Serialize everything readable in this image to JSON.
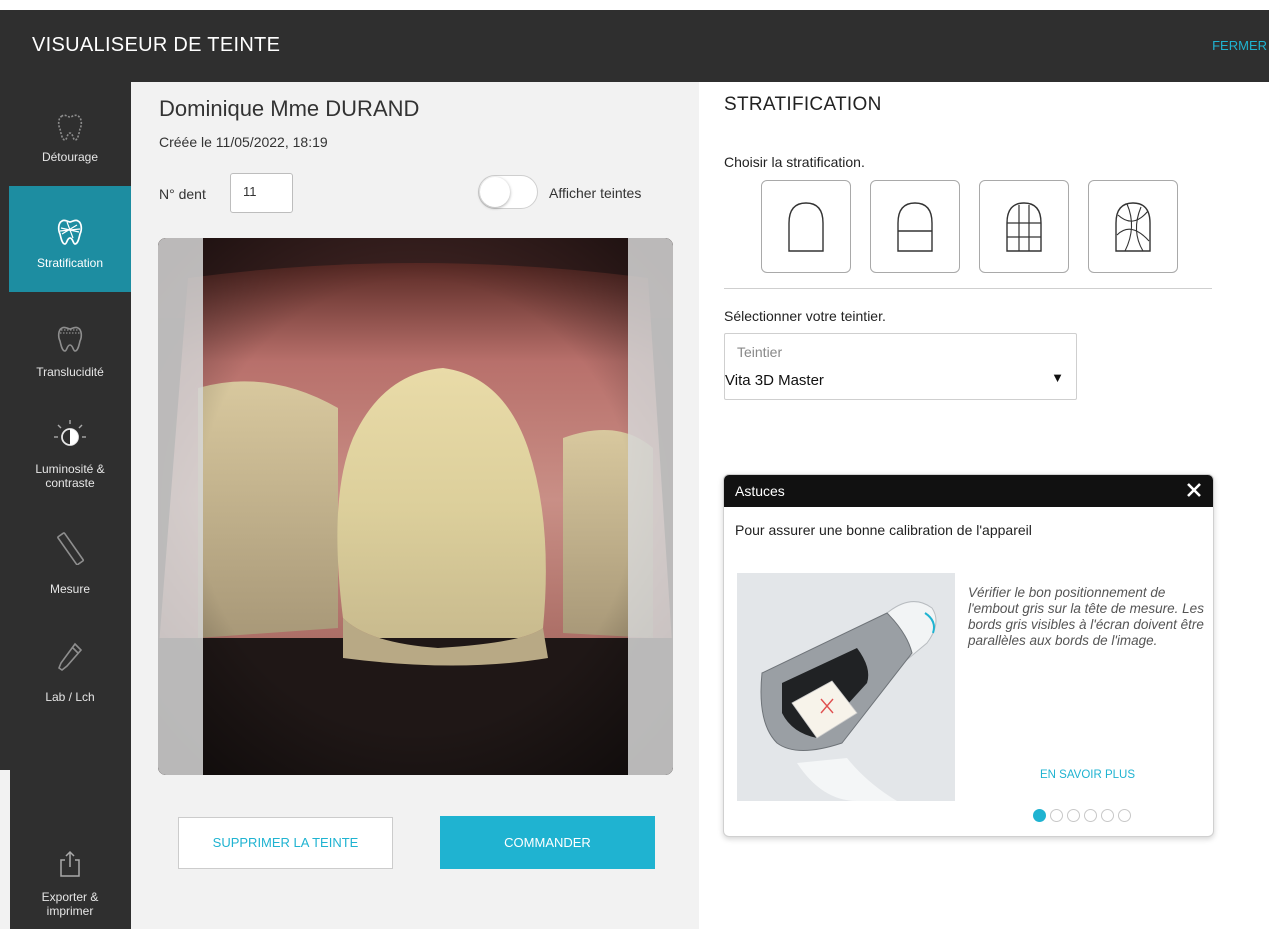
{
  "app": {
    "title": "VISUALISEUR DE TEINTE",
    "close_label": "FERMER",
    "accent_color": "#1fb3d1",
    "sidebar_active_color": "#1d8da1"
  },
  "sidebar": {
    "items": [
      {
        "label": "Détourage",
        "icon": "tooth-outline-icon",
        "active": false
      },
      {
        "label": "Stratification",
        "icon": "tooth-layers-icon",
        "active": true
      },
      {
        "label": "Translucidité",
        "icon": "tooth-translucency-icon",
        "active": false
      },
      {
        "label_line1": "Luminosité &",
        "label_line2": "contraste",
        "icon": "brightness-icon",
        "active": false
      },
      {
        "label": "Mesure",
        "icon": "ruler-icon",
        "active": false
      },
      {
        "label": "Lab / Lch",
        "icon": "pipette-icon",
        "active": false
      },
      {
        "label_line1": "Exporter &",
        "label_line2": "imprimer",
        "icon": "export-icon",
        "active": false
      }
    ]
  },
  "patient": {
    "name": "Dominique Mme DURAND",
    "created": "Créée le 11/05/2022, 18:19",
    "tooth_label": "N° dent",
    "tooth_number": "11",
    "toggle_label": "Afficher teintes",
    "toggle_on": false
  },
  "actions": {
    "delete_label": "SUPPRIMER LA TEINTE",
    "order_label": "COMMANDER"
  },
  "stratification": {
    "title": "STRATIFICATION",
    "instruction": "Choisir la stratification.",
    "options": [
      "strat-single-icon",
      "strat-two-zone-icon",
      "strat-grid-icon",
      "strat-freeform-icon"
    ],
    "select_prompt": "Sélectionner votre teintier.",
    "select_label": "Teintier",
    "select_value": "Vita 3D Master"
  },
  "tips": {
    "title": "Astuces",
    "heading": "Pour assurer une bonne calibration de l'appareil",
    "body": "Vérifier le bon positionnement de l'embout gris sur la tête de mesure. Les bords gris visibles à l'écran doivent être parallèles aux bords de l'image.",
    "more_label": "EN SAVOIR PLUS",
    "page_count": 6,
    "current_page": 1
  }
}
